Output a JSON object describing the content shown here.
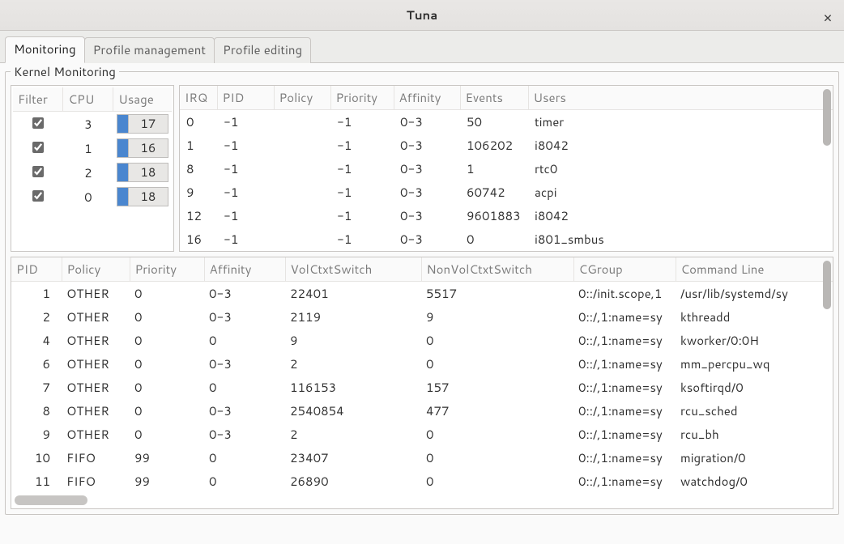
{
  "window": {
    "title": "Tuna",
    "close_glyph": "×"
  },
  "tabs": [
    {
      "label": "Monitoring",
      "active": true
    },
    {
      "label": "Profile management",
      "active": false
    },
    {
      "label": "Profile editing",
      "active": false
    }
  ],
  "section_title": "Kernel Monitoring",
  "cpu_table": {
    "headers": [
      "Filter",
      "CPU",
      "Usage"
    ],
    "rows": [
      {
        "checked": true,
        "cpu": "3",
        "usage": "17"
      },
      {
        "checked": true,
        "cpu": "1",
        "usage": "16"
      },
      {
        "checked": true,
        "cpu": "2",
        "usage": "18"
      },
      {
        "checked": true,
        "cpu": "0",
        "usage": "18"
      }
    ]
  },
  "irq_table": {
    "headers": [
      "IRQ",
      "PID",
      "Policy",
      "Priority",
      "Affinity",
      "Events",
      "Users"
    ],
    "rows": [
      {
        "irq": "0",
        "pid": "-1",
        "policy": "",
        "priority": "-1",
        "affinity": "0-3",
        "events": "50",
        "users": "timer"
      },
      {
        "irq": "1",
        "pid": "-1",
        "policy": "",
        "priority": "-1",
        "affinity": "0-3",
        "events": "106202",
        "users": "i8042"
      },
      {
        "irq": "8",
        "pid": "-1",
        "policy": "",
        "priority": "-1",
        "affinity": "0-3",
        "events": "1",
        "users": "rtc0"
      },
      {
        "irq": "9",
        "pid": "-1",
        "policy": "",
        "priority": "-1",
        "affinity": "0-3",
        "events": "60742",
        "users": "acpi"
      },
      {
        "irq": "12",
        "pid": "-1",
        "policy": "",
        "priority": "-1",
        "affinity": "0-3",
        "events": "9601883",
        "users": "i8042"
      },
      {
        "irq": "16",
        "pid": "-1",
        "policy": "",
        "priority": "-1",
        "affinity": "0-3",
        "events": "0",
        "users": "i801_smbus"
      }
    ]
  },
  "proc_table": {
    "headers": [
      "PID",
      "Policy",
      "Priority",
      "Affinity",
      "VolCtxtSwitch",
      "NonVolCtxtSwitch",
      "CGroup",
      "Command Line"
    ],
    "rows": [
      {
        "pid": "1",
        "policy": "OTHER",
        "priority": "0",
        "affinity": "0-3",
        "vcs": "22401",
        "nvcs": "5517",
        "cgroup": "0::/init.scope,1",
        "cmd": "/usr/lib/systemd/sy"
      },
      {
        "pid": "2",
        "policy": "OTHER",
        "priority": "0",
        "affinity": "0-3",
        "vcs": "2119",
        "nvcs": "9",
        "cgroup": "0::/,1:name=sy",
        "cmd": "kthreadd"
      },
      {
        "pid": "4",
        "policy": "OTHER",
        "priority": "0",
        "affinity": "0",
        "vcs": "9",
        "nvcs": "0",
        "cgroup": "0::/,1:name=sy",
        "cmd": "kworker/0:0H"
      },
      {
        "pid": "6",
        "policy": "OTHER",
        "priority": "0",
        "affinity": "0-3",
        "vcs": "2",
        "nvcs": "0",
        "cgroup": "0::/,1:name=sy",
        "cmd": "mm_percpu_wq"
      },
      {
        "pid": "7",
        "policy": "OTHER",
        "priority": "0",
        "affinity": "0",
        "vcs": "116153",
        "nvcs": "157",
        "cgroup": "0::/,1:name=sy",
        "cmd": "ksoftirqd/0"
      },
      {
        "pid": "8",
        "policy": "OTHER",
        "priority": "0",
        "affinity": "0-3",
        "vcs": "2540854",
        "nvcs": "477",
        "cgroup": "0::/,1:name=sy",
        "cmd": "rcu_sched"
      },
      {
        "pid": "9",
        "policy": "OTHER",
        "priority": "0",
        "affinity": "0-3",
        "vcs": "2",
        "nvcs": "0",
        "cgroup": "0::/,1:name=sy",
        "cmd": "rcu_bh"
      },
      {
        "pid": "10",
        "policy": "FIFO",
        "priority": "99",
        "affinity": "0",
        "vcs": "23407",
        "nvcs": "0",
        "cgroup": "0::/,1:name=sy",
        "cmd": "migration/0"
      },
      {
        "pid": "11",
        "policy": "FIFO",
        "priority": "99",
        "affinity": "0",
        "vcs": "26890",
        "nvcs": "0",
        "cgroup": "0::/,1:name=sy",
        "cmd": "watchdog/0"
      }
    ]
  }
}
